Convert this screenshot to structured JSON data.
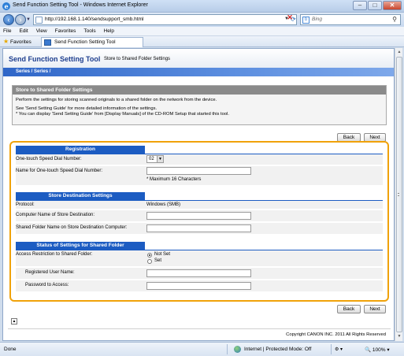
{
  "window": {
    "title": "Send Function Setting Tool - Windows Internet Explorer",
    "minimize": "‒",
    "maximize": "□",
    "close": "✕"
  },
  "address": {
    "url": "http://192.168.1.140/sendsupport_smb.html",
    "search_placeholder": "Bing"
  },
  "menu": [
    "File",
    "Edit",
    "View",
    "Favorites",
    "Tools",
    "Help"
  ],
  "favorites": {
    "label": "Favorites",
    "tab_title": "Send Function Setting Tool"
  },
  "app": {
    "title": "Send Function Setting Tool",
    "subtitle": "Store to Shared Folder Settings",
    "breadcrumb": "Series /      Series /"
  },
  "info": {
    "heading": "Store to Shared Folder Settings",
    "line1": "Perform the settings for storing scanned originals to a shared folder on the network from the device.",
    "line2": "See 'Send Setting Guide' for more detailed information of the settings.",
    "line3": "* You can display 'Send Setting Guide' from [Display Manuals] of the CD-ROM Setup that started this tool."
  },
  "buttons": {
    "back": "Back",
    "next": "Next"
  },
  "registration": {
    "heading": "Registration",
    "speed_dial_label": "One-touch Speed Dial Number:",
    "speed_dial_value": "02",
    "name_label": "Name for One-touch Speed Dial Number:",
    "name_value": "",
    "name_note": "* Maximum 16 Characters"
  },
  "destination": {
    "heading": "Store Destination Settings",
    "protocol_label": "Protocol:",
    "protocol_value": "Windows (SMB)",
    "computer_label": "Computer Name of Store Destination:",
    "computer_value": "",
    "folder_label": "Shared Folder Name on Store Destination Computer:",
    "folder_value": ""
  },
  "status": {
    "heading": "Status of Settings for Shared Folder",
    "restriction_label": "Access Restriction to Shared Folder:",
    "option_not_set": "Not Set",
    "option_set": "Set",
    "selected": "Not Set",
    "user_label": "Registered User Name:",
    "user_value": "",
    "password_label": "Password to Access:",
    "password_value": ""
  },
  "footer": {
    "copyright": "Copyright CANON INC. 2011 All Rights Reserved"
  },
  "statusbar": {
    "text": "Done",
    "zone": "Internet | Protected Mode: Off",
    "zoom": "100%"
  },
  "icons": [
    "ie-logo-icon",
    "back-arrow-icon",
    "forward-arrow-icon",
    "refresh-icon",
    "stop-icon",
    "bing-icon",
    "search-icon",
    "favorites-star-icon",
    "page-icon",
    "globe-icon",
    "page-top-icon"
  ]
}
